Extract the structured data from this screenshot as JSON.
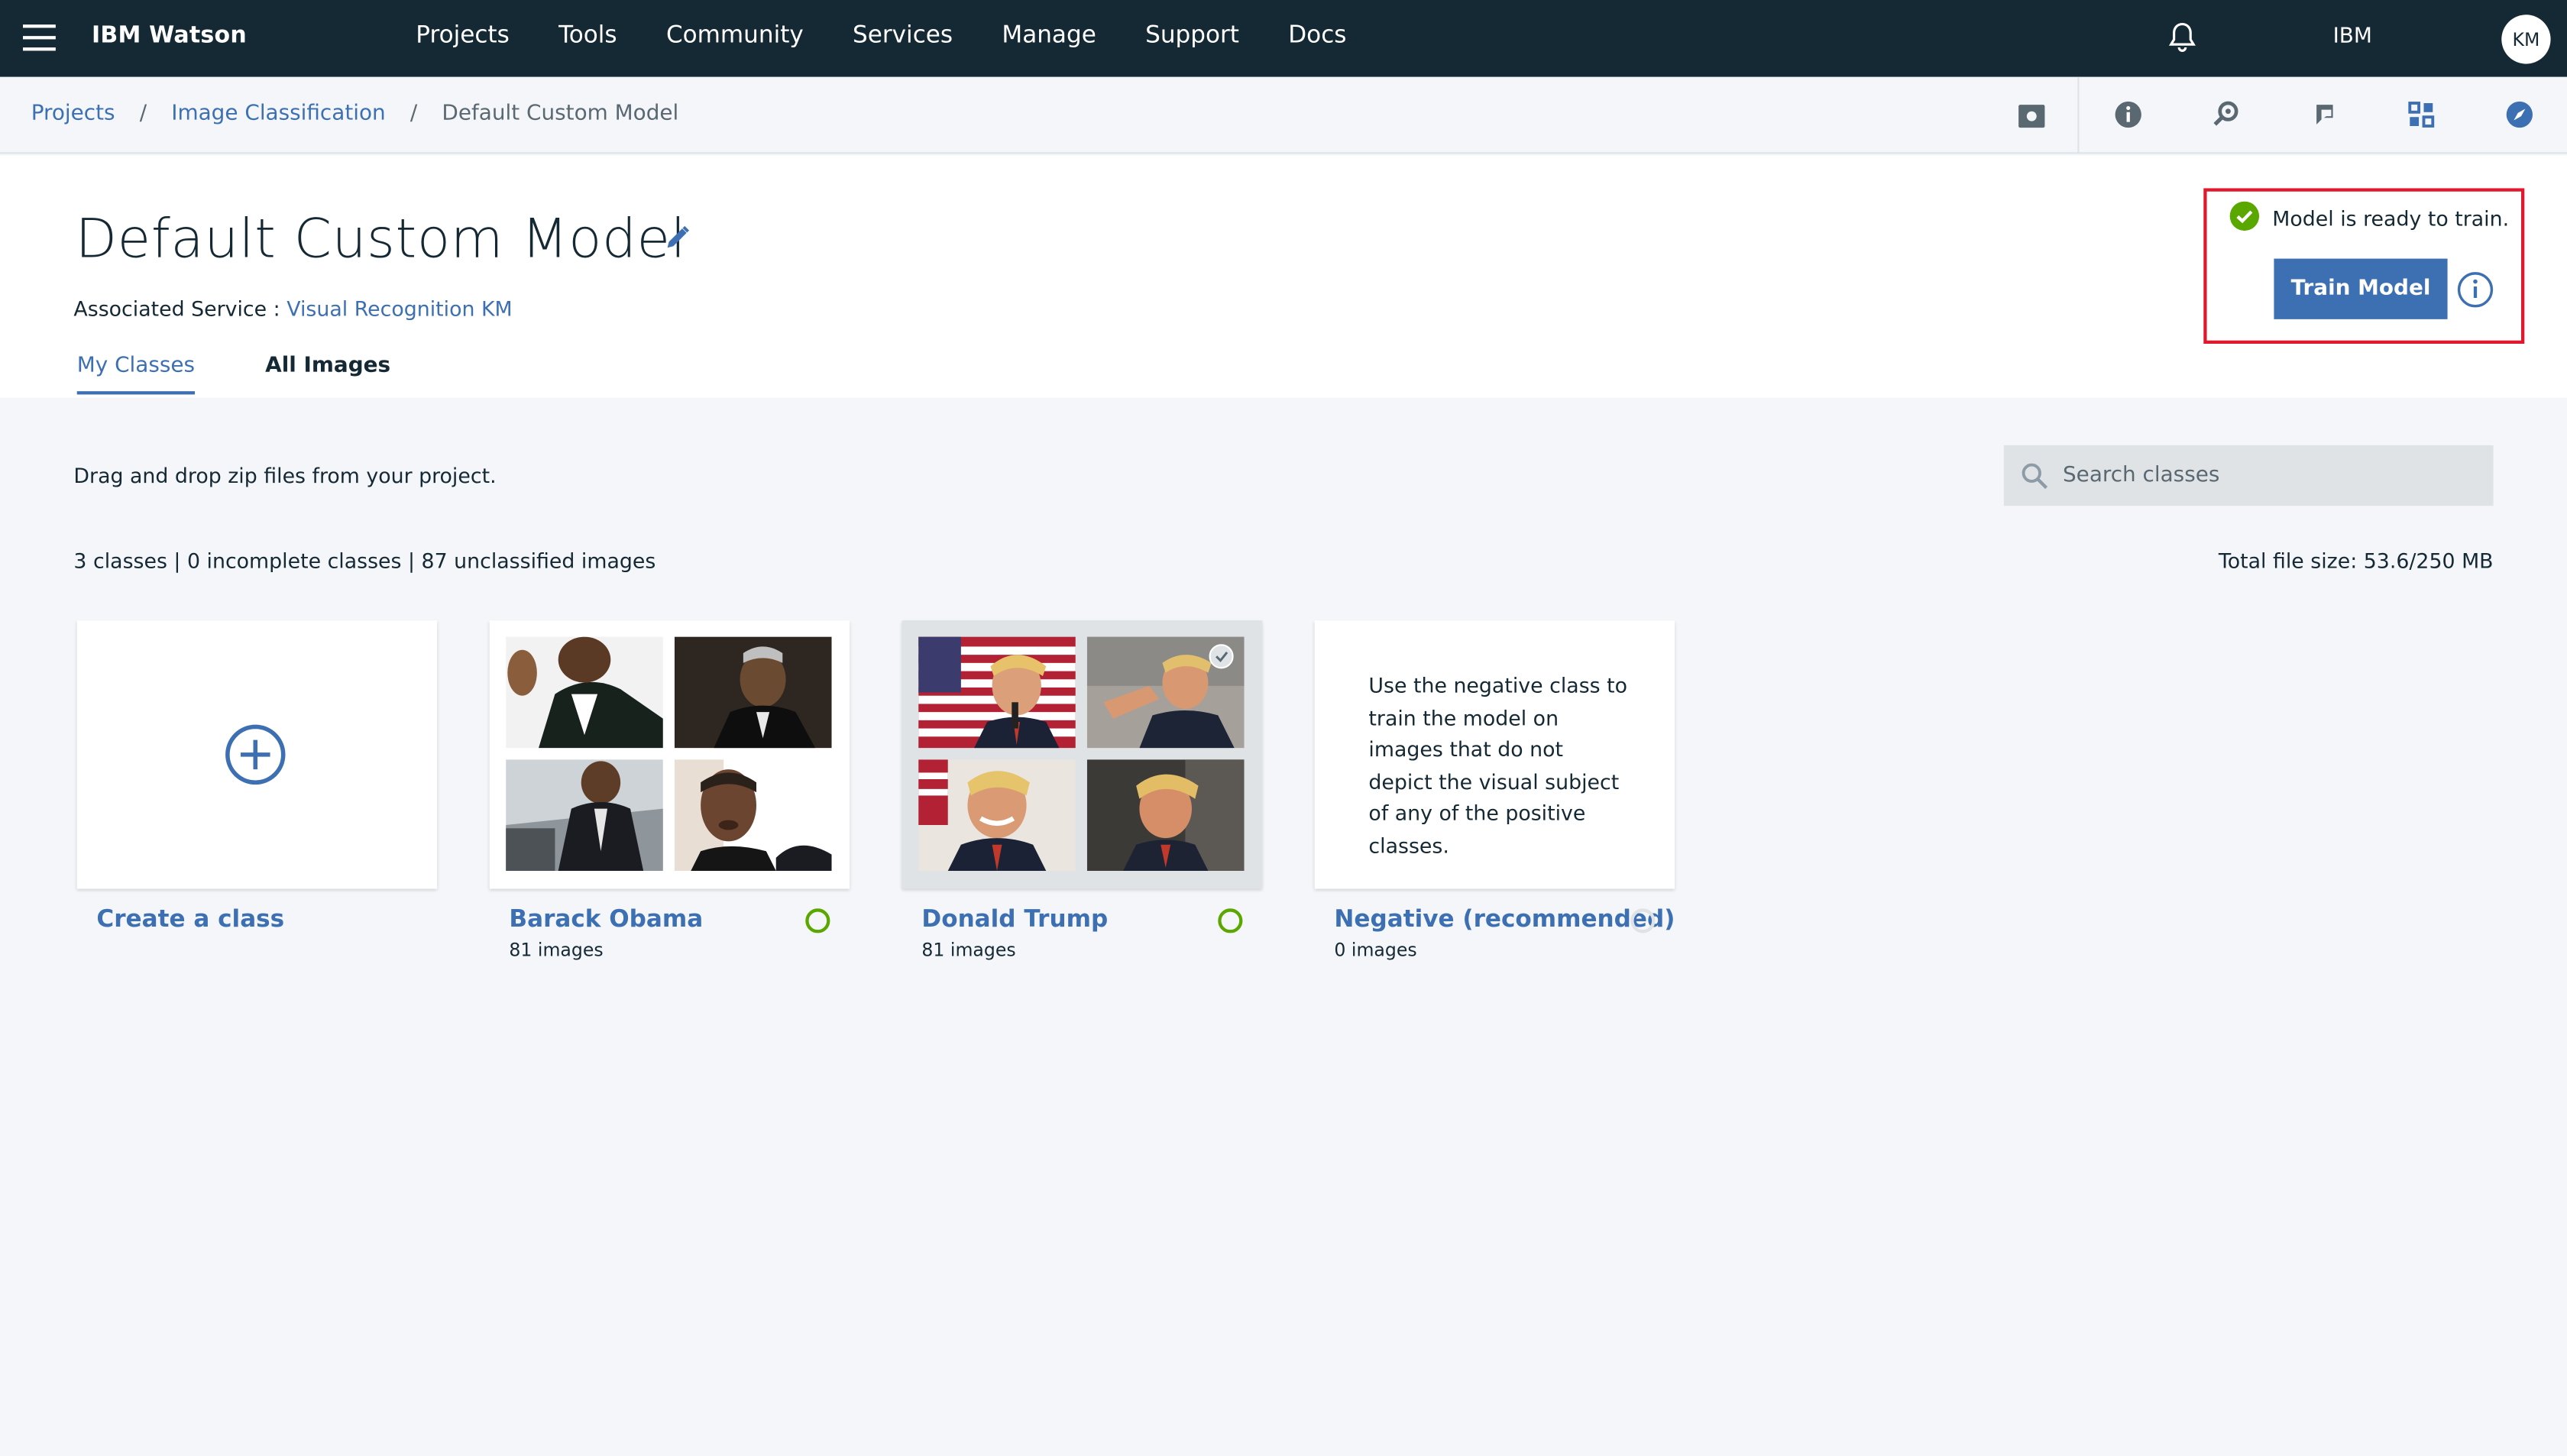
{
  "topbar": {
    "brand": "IBM Watson",
    "nav": [
      "Projects",
      "Tools",
      "Community",
      "Services",
      "Manage",
      "Support",
      "Docs"
    ],
    "org": "IBM",
    "avatar_initials": "KM"
  },
  "breadcrumb": {
    "items": [
      "Projects",
      "Image Classification"
    ],
    "current": "Default Custom Model",
    "separator": "/"
  },
  "toolbar_icons": [
    "screen-icon",
    "info-icon",
    "tools-icon",
    "community-icon",
    "grid-icon",
    "compass-icon"
  ],
  "model": {
    "title": "Default Custom Model",
    "assoc_label": "Associated Service :",
    "assoc_service": "Visual Recognition KM",
    "tabs": [
      "My Classes",
      "All Images"
    ],
    "status_text": "Model is ready to train.",
    "train_label": "Train Model"
  },
  "content": {
    "drag_text": "Drag and drop zip files from your project.",
    "search_placeholder": "Search classes",
    "stats": "3 classes | 0 incomplete classes | 87 unclassified images",
    "file_size": "Total file size: 53.6/250 MB"
  },
  "classes": {
    "create_label": "Create a class",
    "obama": {
      "name": "Barack Obama",
      "count": "81 images"
    },
    "trump": {
      "name": "Donald Trump",
      "count": "81 images"
    },
    "negative": {
      "name": "Negative (recommended)",
      "count": "0 images",
      "description": "Use the negative class to train the model on images that do not depict the visual subject of any of the positive classes."
    }
  },
  "colors": {
    "nav_bg": "#152935",
    "accent": "#3d70b2",
    "ready_green": "#5aa700",
    "highlight_red": "#e0182d"
  }
}
